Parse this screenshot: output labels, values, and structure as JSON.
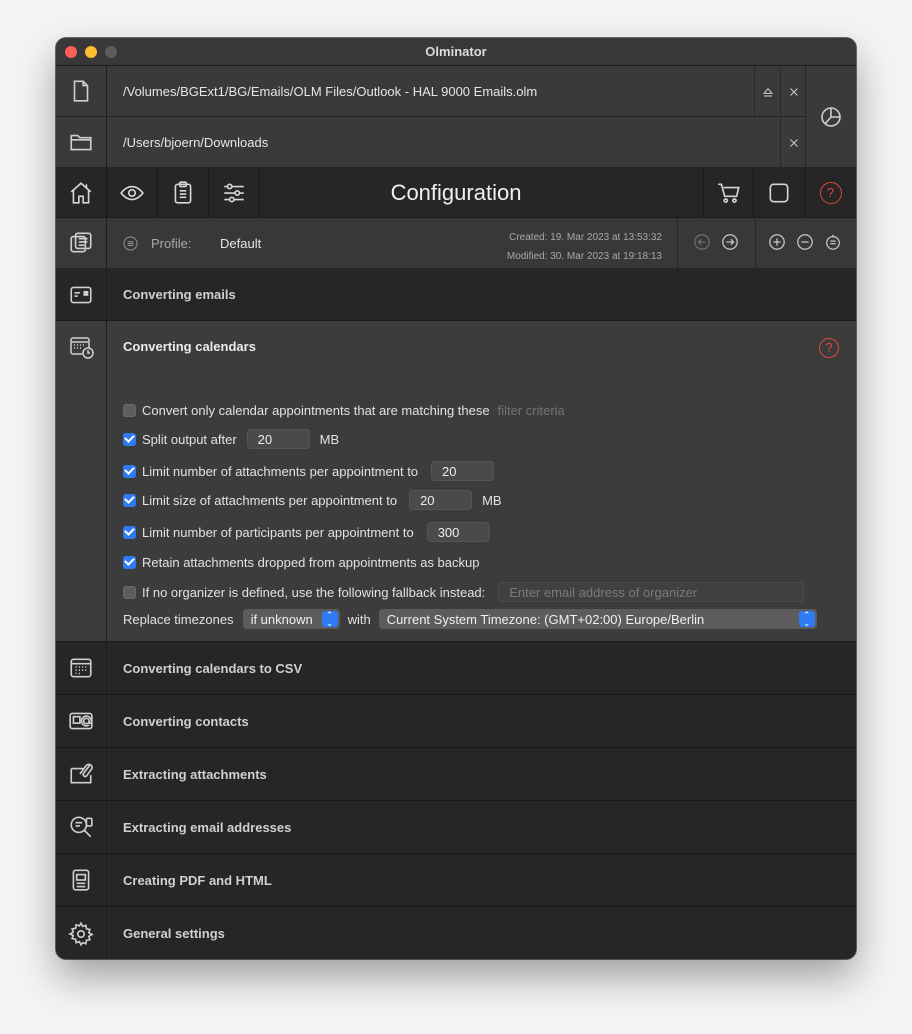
{
  "app": {
    "title": "Olminator"
  },
  "paths": {
    "source": "/Volumes/BGExt1/BG/Emails/OLM Files/Outlook - HAL 9000 Emails.olm",
    "destination": "/Users/bjoern/Downloads"
  },
  "toolbar": {
    "title": "Configuration"
  },
  "profile": {
    "label": "Profile:",
    "value": "Default",
    "created": "Created: 19. Mar 2023 at 13:53:32",
    "modified": "Modified: 30. Mar 2023 at 19:18:13"
  },
  "sections": {
    "emails": "Converting emails",
    "calendars": "Converting calendars",
    "calendars_csv": "Converting calendars to CSV",
    "contacts": "Converting contacts",
    "attachments": "Extracting attachments",
    "addresses": "Extracting email addresses",
    "pdf": "Creating PDF and HTML",
    "general": "General settings"
  },
  "calendar": {
    "help": "?",
    "filter_only": "Convert only calendar appointments that are matching these",
    "filter_link": "filter criteria",
    "split_label": "Split output after",
    "split_value": "20",
    "split_unit": "MB",
    "limit_att_label": "Limit number of attachments per appointment to",
    "limit_att_value": "20",
    "limit_size_label": "Limit size of attachments per appointment to",
    "limit_size_value": "20",
    "limit_size_unit": "MB",
    "limit_part_label": "Limit number of participants per appointment to",
    "limit_part_value": "300",
    "retain_label": "Retain attachments dropped from appointments as backup",
    "organizer_label": "If no organizer is defined, use the following fallback instead:",
    "organizer_placeholder": "Enter email address of organizer",
    "tz_label": "Replace timezones",
    "tz_mode": "if unknown",
    "tz_with": "with",
    "tz_value": "Current System Timezone: (GMT+02:00) Europe/Berlin"
  },
  "colors": {
    "accent": "#2f7bf5",
    "help": "#e0473f"
  }
}
